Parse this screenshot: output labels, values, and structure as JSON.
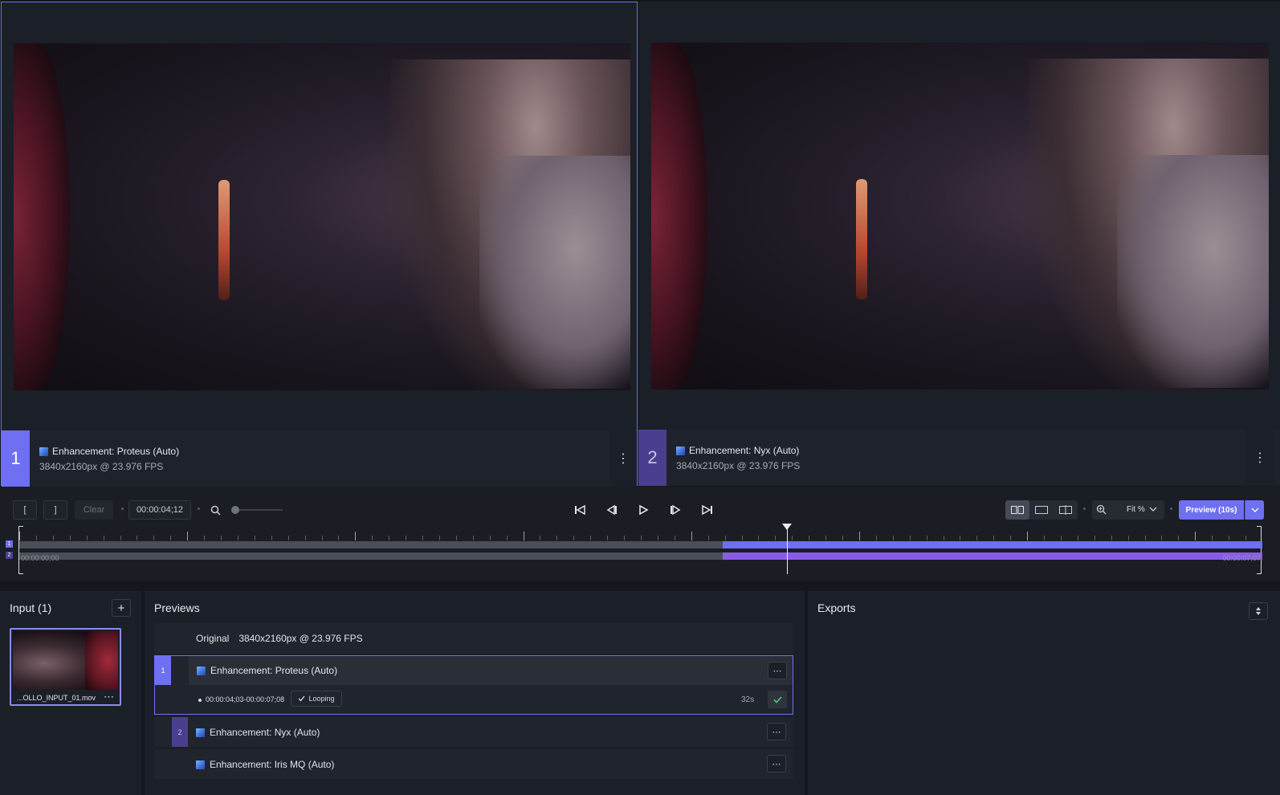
{
  "viewers": [
    {
      "index": "1",
      "title": "Enhancement: Proteus (Auto)",
      "subtitle": "3840x2160px @ 23.976 FPS",
      "menu_icon": "kebab-icon"
    },
    {
      "index": "2",
      "title": "Enhancement: Nyx (Auto)",
      "subtitle": "3840x2160px @ 23.976 FPS",
      "menu_icon": "kebab-icon"
    }
  ],
  "controls": {
    "mark_in": "[",
    "mark_out": "]",
    "clear": "Clear",
    "timecode": "00:00:04;12",
    "zoom_label": "Fit %",
    "preview_button": "Preview (10s)",
    "play_icons": [
      "skip-start-icon",
      "step-back-icon",
      "play-icon",
      "step-forward-icon",
      "skip-end-icon"
    ],
    "view_modes": [
      "side-by-side-icon",
      "single-view-icon",
      "split-view-icon"
    ]
  },
  "timeline": {
    "start": "00:00:00;00",
    "end": "00:00:07;07",
    "tracks": [
      "1",
      "2"
    ],
    "playhead_fraction": 0.6175,
    "preview_start_fraction": 0.566
  },
  "input": {
    "title": "Input (1)",
    "add_icon": "plus-icon",
    "file_name": "...OLLO_INPUT_01.mov",
    "file_menu": "⋯"
  },
  "previews": {
    "title": "Previews",
    "original_label": "Original",
    "original_info": "3840x2160px @ 23.976 FPS",
    "items": [
      {
        "num": "1",
        "label": "Enhancement: Proteus (Auto)",
        "menu": "⋯"
      },
      {
        "num": "2",
        "label": "Enhancement: Nyx (Auto)",
        "menu": "⋯"
      },
      {
        "num": "",
        "label": "Enhancement: Iris MQ (Auto)",
        "menu": "⋯"
      }
    ],
    "active_detail": {
      "range": "00:00:04;03-00:00:07;08",
      "looping": "Looping",
      "duration": "32s"
    }
  },
  "exports": {
    "title": "Exports",
    "sort_icon": "sort-icon"
  },
  "colors": {
    "accent": "#6f6ff2",
    "accent_dark": "#4a3f8e",
    "track_fill_1": "#6f6ff2",
    "track_fill_2": "#8a5ce6",
    "background": "#14171d"
  }
}
